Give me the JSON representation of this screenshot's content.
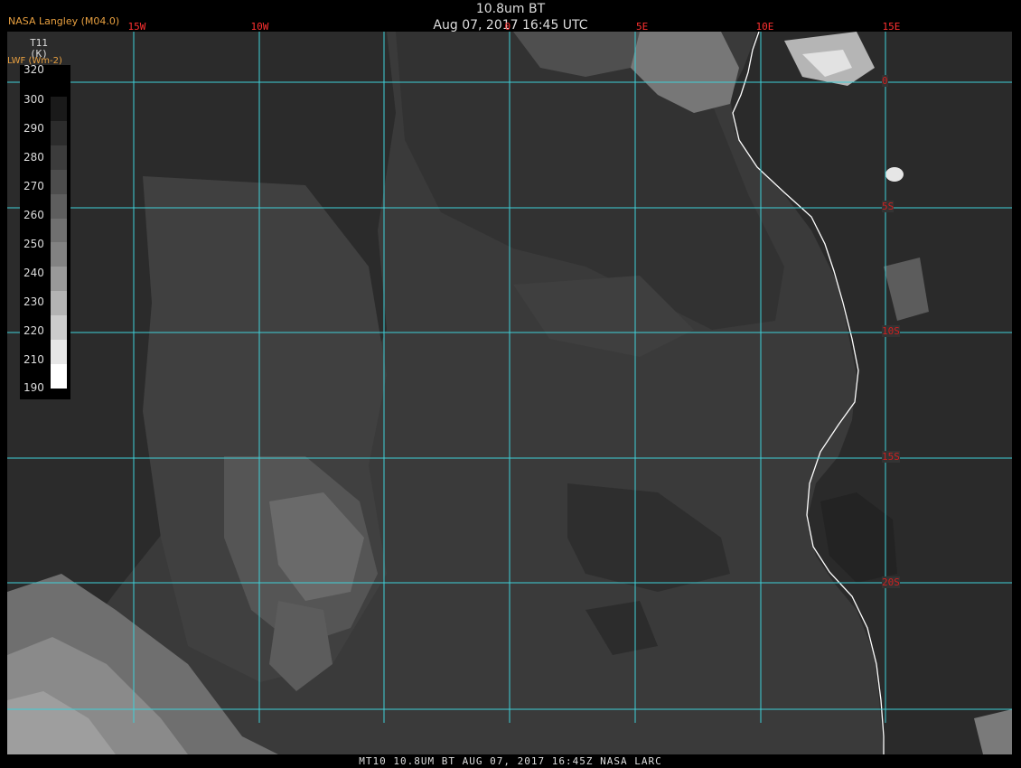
{
  "header": {
    "title": "10.8um BT",
    "subtitle": "Aug 07, 2017 16:45 UTC",
    "provider": "NASA Langley (M04.0)"
  },
  "legend": {
    "variable_line1": "T11",
    "variable_line2": "(K)",
    "overlay_label": "LWF (Wm-2)",
    "ticks": [
      "320",
      "300",
      "290",
      "280",
      "270",
      "260",
      "250",
      "240",
      "230",
      "220",
      "210",
      "190"
    ],
    "swatch_colors": [
      "#000000",
      "#1a1a1a",
      "#2c2c2c",
      "#3c3c3c",
      "#4d4d4d",
      "#5e5e5e",
      "#707070",
      "#828282",
      "#999999",
      "#b3b3b3",
      "#cccccc",
      "#e6e6e6",
      "#ffffff"
    ]
  },
  "grid": {
    "lon_labels": [
      "15W",
      "10W",
      "0",
      "5E",
      "10E",
      "15E"
    ],
    "lat_labels": [
      "0",
      "5S",
      "10S",
      "15S",
      "20S"
    ],
    "line_color": "#3fd0d8",
    "coast_color": "#ffffff"
  },
  "footer": {
    "text": "MT10  10.8UM BT   AUG 07, 2017 16:45Z   NASA LARC"
  }
}
